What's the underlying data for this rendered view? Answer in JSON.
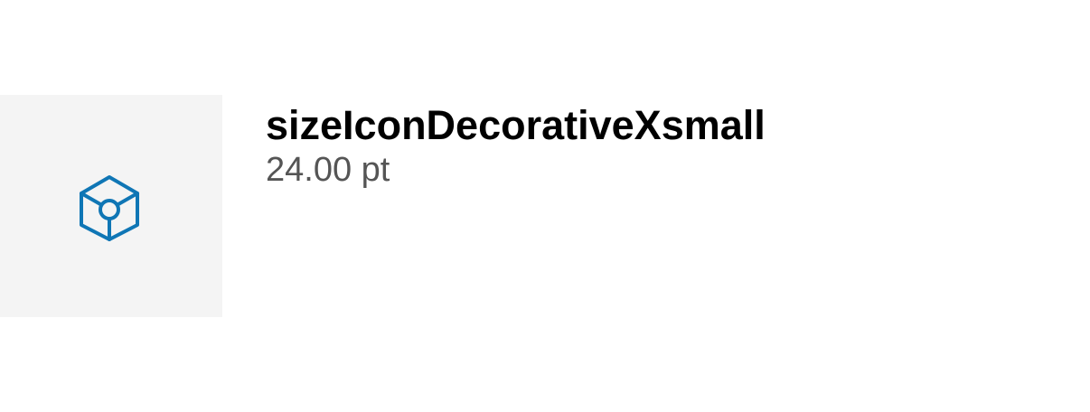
{
  "token": {
    "name": "sizeIconDecorativeXsmall",
    "value": "24.00 pt",
    "icon": "cube-icon",
    "icon_color": "#0f76b5",
    "swatch_background": "#f4f4f4"
  }
}
